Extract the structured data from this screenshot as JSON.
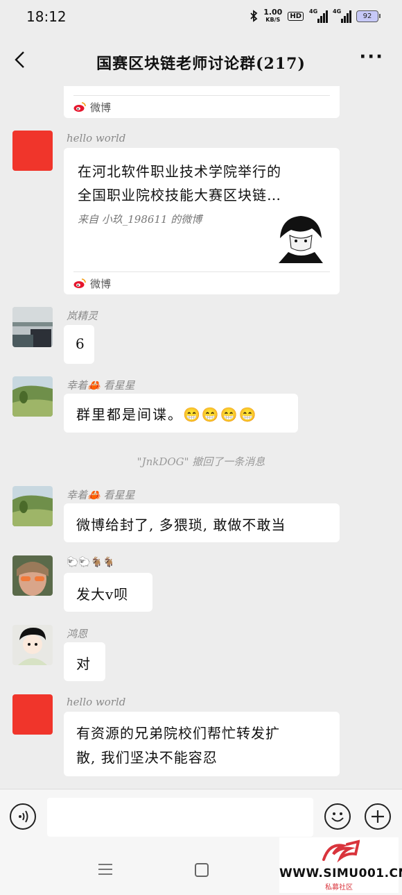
{
  "status_bar": {
    "time": "18:12",
    "speed_value": "1.00",
    "speed_unit": "KB/S",
    "hd": "HD",
    "net1": "4G",
    "net2": "4G",
    "battery": "92"
  },
  "header": {
    "title": "国赛区块链老师讨论群(217)"
  },
  "messages": [
    {
      "source": "微博"
    },
    {
      "sender": "hello world",
      "card_line1": "在河北软件职业技术学院举行的",
      "card_line2": "全国职业院校技能大赛区块链…",
      "card_from": "来自  小玖_198611  的微博",
      "source": "微博"
    },
    {
      "sender": "岚精灵",
      "text": "6"
    },
    {
      "sender": "幸着🦀  看星星",
      "text": "群里都是间谍。😁😁😁😁"
    },
    {
      "sender": "幸着🦀  看星星",
      "text": "微博给封了, 多猥琐, 敢做不敢当"
    },
    {
      "sender": "🐑🐑🐐🐐",
      "text": "发大v呗"
    },
    {
      "sender": "鸿恩",
      "text": "对"
    },
    {
      "sender": "hello world",
      "text_line1": "有资源的兄弟院校们帮忙转发扩",
      "text_line2": "散, 我们坚决不能容忍"
    }
  ],
  "system_notice": "\"JnkDOG\" 撤回了一条消息",
  "watermark": {
    "text": "WWW.SIMU001.CN",
    "sub": "私募社区"
  },
  "colors": {
    "accent_red": "#f0352b",
    "background": "#ededed"
  }
}
